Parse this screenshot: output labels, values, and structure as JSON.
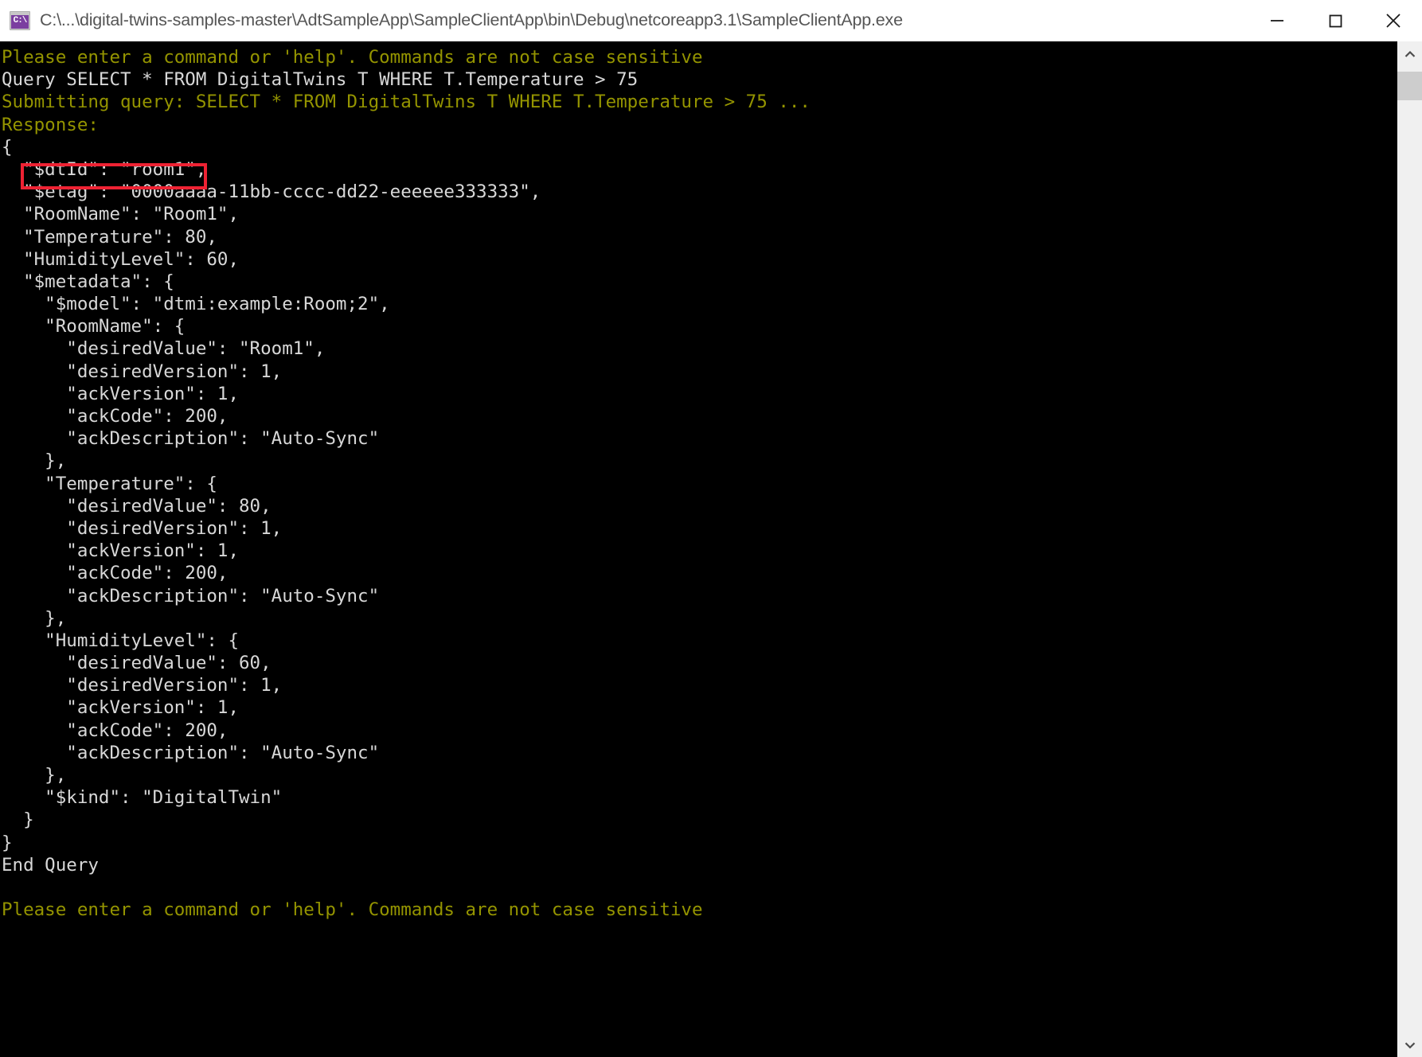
{
  "window": {
    "title": "C:\\...\\digital-twins-samples-master\\AdtSampleApp\\SampleClientApp\\bin\\Debug\\netcoreapp3.1\\SampleClientApp.exe",
    "icon": "console-cmd-icon",
    "icon_glyph": "C:\\",
    "controls": {
      "minimize": "minimize-icon",
      "maximize": "maximize-icon",
      "close": "close-icon"
    }
  },
  "colors": {
    "background": "#000000",
    "prompt_text": "#949400",
    "body_text": "#d8d8d8",
    "annotation": "#ee2233",
    "title_text": "#555555",
    "icon_purple": "#7b3fa0",
    "scrollbar_track": "#f0f0f0",
    "scrollbar_thumb": "#cdcdcd"
  },
  "annotation": {
    "name": "dtid-highlight-box",
    "target_text": "\"$dtId\": \"room1\","
  },
  "scrollbar": {
    "up_arrow": "chevron-up-icon",
    "down_arrow": "chevron-down-icon"
  },
  "console": {
    "lines": [
      {
        "text": "Please enter a command or 'help'. Commands are not case sensitive",
        "style": "prompt"
      },
      {
        "text": "Query SELECT * FROM DigitalTwins T WHERE T.Temperature > 75",
        "style": "white"
      },
      {
        "text": "Submitting query: SELECT * FROM DigitalTwins T WHERE T.Temperature > 75 ...",
        "style": "prompt"
      },
      {
        "text": "Response:",
        "style": "prompt"
      },
      {
        "text": "{",
        "style": "white"
      },
      {
        "text": "  \"$dtId\": \"room1\",",
        "style": "white"
      },
      {
        "text": "  \"$etag\": \"0000aaaa-11bb-cccc-dd22-eeeeee333333\",",
        "style": "white"
      },
      {
        "text": "  \"RoomName\": \"Room1\",",
        "style": "white"
      },
      {
        "text": "  \"Temperature\": 80,",
        "style": "white"
      },
      {
        "text": "  \"HumidityLevel\": 60,",
        "style": "white"
      },
      {
        "text": "  \"$metadata\": {",
        "style": "white"
      },
      {
        "text": "    \"$model\": \"dtmi:example:Room;2\",",
        "style": "white"
      },
      {
        "text": "    \"RoomName\": {",
        "style": "white"
      },
      {
        "text": "      \"desiredValue\": \"Room1\",",
        "style": "white"
      },
      {
        "text": "      \"desiredVersion\": 1,",
        "style": "white"
      },
      {
        "text": "      \"ackVersion\": 1,",
        "style": "white"
      },
      {
        "text": "      \"ackCode\": 200,",
        "style": "white"
      },
      {
        "text": "      \"ackDescription\": \"Auto-Sync\"",
        "style": "white"
      },
      {
        "text": "    },",
        "style": "white"
      },
      {
        "text": "    \"Temperature\": {",
        "style": "white"
      },
      {
        "text": "      \"desiredValue\": 80,",
        "style": "white"
      },
      {
        "text": "      \"desiredVersion\": 1,",
        "style": "white"
      },
      {
        "text": "      \"ackVersion\": 1,",
        "style": "white"
      },
      {
        "text": "      \"ackCode\": 200,",
        "style": "white"
      },
      {
        "text": "      \"ackDescription\": \"Auto-Sync\"",
        "style": "white"
      },
      {
        "text": "    },",
        "style": "white"
      },
      {
        "text": "    \"HumidityLevel\": {",
        "style": "white"
      },
      {
        "text": "      \"desiredValue\": 60,",
        "style": "white"
      },
      {
        "text": "      \"desiredVersion\": 1,",
        "style": "white"
      },
      {
        "text": "      \"ackVersion\": 1,",
        "style": "white"
      },
      {
        "text": "      \"ackCode\": 200,",
        "style": "white"
      },
      {
        "text": "      \"ackDescription\": \"Auto-Sync\"",
        "style": "white"
      },
      {
        "text": "    },",
        "style": "white"
      },
      {
        "text": "    \"$kind\": \"DigitalTwin\"",
        "style": "white"
      },
      {
        "text": "  }",
        "style": "white"
      },
      {
        "text": "}",
        "style": "white"
      },
      {
        "text": "End Query",
        "style": "white"
      },
      {
        "text": "",
        "style": "blank"
      },
      {
        "text": "Please enter a command or 'help'. Commands are not case sensitive",
        "style": "prompt"
      }
    ]
  }
}
